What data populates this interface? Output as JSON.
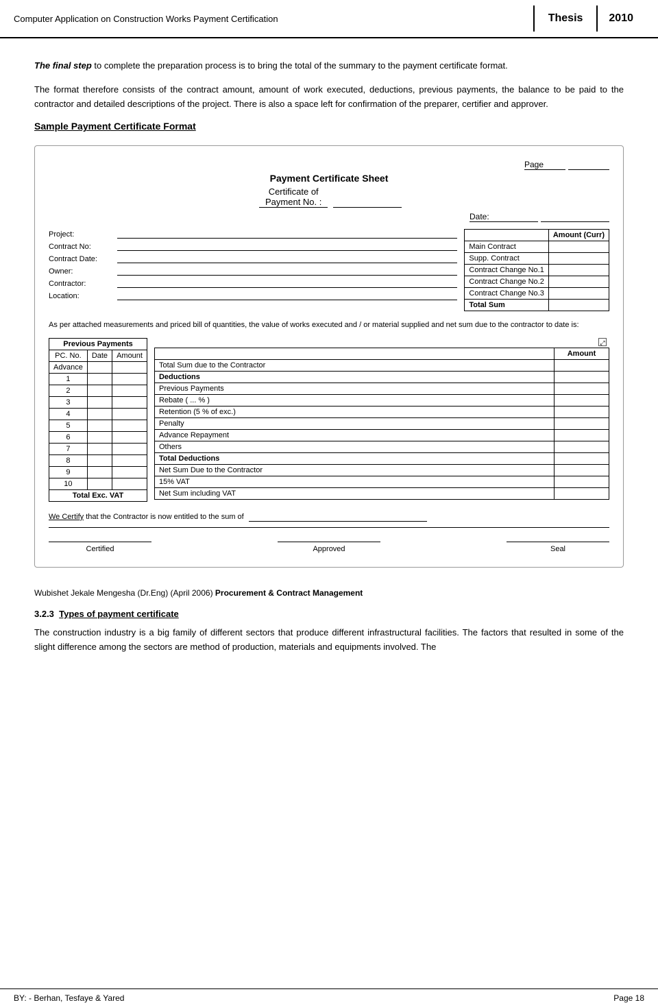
{
  "header": {
    "title": "Computer Application on Construction Works Payment Certification",
    "thesis_label": "Thesis",
    "year": "2010"
  },
  "intro": {
    "paragraph1_bold_italic": "The final step",
    "paragraph1_rest": " to complete the preparation process is to bring the total of the summary to the payment certificate format.",
    "paragraph2": "The format therefore consists of the contract amount, amount of work executed, deductions, previous payments, the balance to be paid to the contractor and detailed descriptions of the project. There is also a space left for confirmation of the preparer, certifier and approver."
  },
  "section_heading": "Sample Payment Certificate Format",
  "certificate": {
    "sheet_title": "Payment Certificate Sheet",
    "cert_no_label": "Certificate of Payment No. :",
    "page_label": "Page",
    "date_label": "Date:",
    "left_fields": [
      {
        "label": "Project:"
      },
      {
        "label": "Contract No:"
      },
      {
        "label": "Contract Date:"
      },
      {
        "label": "Owner:"
      },
      {
        "label": "Contractor:"
      },
      {
        "label": "Location:"
      }
    ],
    "right_table_header": "Amount (Curr)",
    "right_table_rows": [
      {
        "label": "Main Contract",
        "amount": ""
      },
      {
        "label": "Supp. Contract",
        "amount": ""
      },
      {
        "label": "Contract Change No.1",
        "amount": ""
      },
      {
        "label": "Contract Change No.2",
        "amount": ""
      },
      {
        "label": "Contract Change No.3",
        "amount": ""
      },
      {
        "label": "Total Sum",
        "amount": "",
        "bold": true
      }
    ],
    "description": "As per attached measurements and priced bill of quantities, the value of works executed and / or material supplied and net sum due to the contractor to date is:",
    "prev_payments_header": "Previous Payments",
    "prev_payments_cols": [
      "PC. No.",
      "Date",
      "Amount"
    ],
    "prev_payments_rows": [
      {
        "no": "Advance",
        "date": "",
        "amount": ""
      },
      {
        "no": "1",
        "date": "",
        "amount": ""
      },
      {
        "no": "2",
        "date": "",
        "amount": ""
      },
      {
        "no": "3",
        "date": "",
        "amount": ""
      },
      {
        "no": "4",
        "date": "",
        "amount": ""
      },
      {
        "no": "5",
        "date": "",
        "amount": ""
      },
      {
        "no": "6",
        "date": "",
        "amount": ""
      },
      {
        "no": "7",
        "date": "",
        "amount": ""
      },
      {
        "no": "8",
        "date": "",
        "amount": ""
      },
      {
        "no": "9",
        "date": "",
        "amount": ""
      },
      {
        "no": "10",
        "date": "",
        "amount": ""
      }
    ],
    "prev_total_label": "Total Exc. VAT",
    "right_summary_header": "Amount",
    "right_summary_rows": [
      {
        "label": "Total Sum due to the Contractor",
        "amount": "",
        "bold": false
      },
      {
        "label": "Deductions",
        "amount": "",
        "bold": true
      },
      {
        "label": "Previous Payments",
        "amount": "",
        "bold": false
      },
      {
        "label": "Rebate ( ... % )",
        "amount": "",
        "bold": false
      },
      {
        "label": "Retention (5 % of exc.)",
        "amount": "",
        "bold": false
      },
      {
        "label": "Penalty",
        "amount": "",
        "bold": false
      },
      {
        "label": "Advance Repayment",
        "amount": "",
        "bold": false
      },
      {
        "label": "Others",
        "amount": "",
        "bold": false
      },
      {
        "label": "Total Deductions",
        "amount": "",
        "bold": true
      },
      {
        "label": "Net Sum Due to the Contractor",
        "amount": "",
        "bold": false
      },
      {
        "label": "15% VAT",
        "amount": "",
        "bold": false
      },
      {
        "label": "Net Sum including VAT",
        "amount": "",
        "bold": false
      }
    ],
    "certify_text_underline": "We Certify",
    "certify_text_rest": " that the Contractor is now entitled to the sum of",
    "signatures": [
      {
        "label": "Certified"
      },
      {
        "label": "Approved"
      },
      {
        "label": "Seal"
      }
    ]
  },
  "footer_citation": {
    "author": "Wubishet Jekale Mengesha (Dr.Eng) (April 2006)",
    "bold_part": "Procurement & Contract Management"
  },
  "subsection": {
    "number": "3.2.3",
    "title": "Types of payment certificate",
    "body": "The construction industry is a big family of different sectors that produce different infrastructural facilities. The factors that resulted in some of the slight difference among the sectors are method of production, materials and equipments involved. The"
  },
  "page_footer": {
    "left": "BY: - Berhan, Tesfaye & Yared",
    "right": "Page 18"
  }
}
